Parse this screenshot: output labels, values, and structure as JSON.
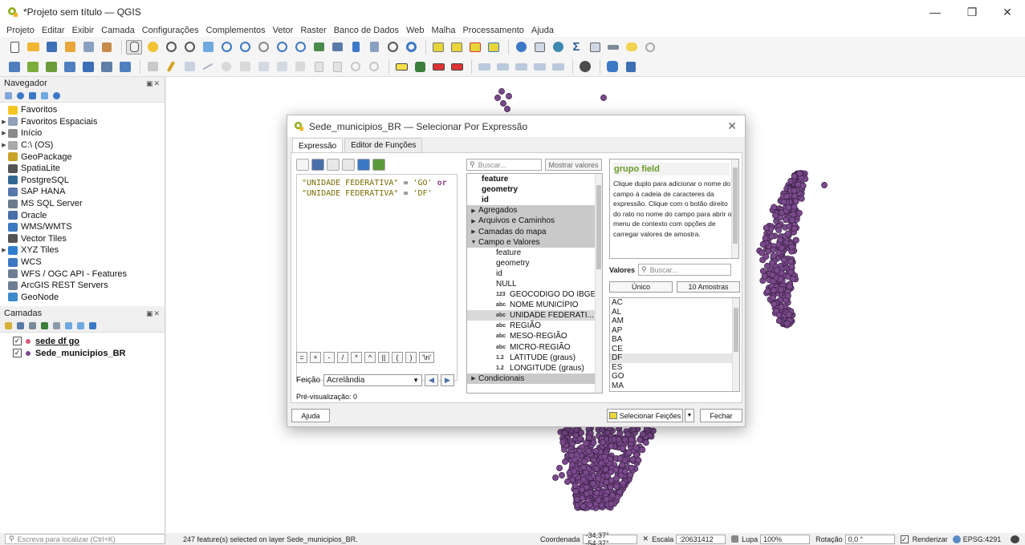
{
  "window": {
    "title": "*Projeto sem título — QGIS",
    "controls": [
      "—",
      "❐",
      "✕"
    ]
  },
  "menu": [
    "Projeto",
    "Editar",
    "Exibir",
    "Camada",
    "Configurações",
    "Complementos",
    "Vetor",
    "Raster",
    "Banco de Dados",
    "Web",
    "Malha",
    "Processamento",
    "Ajuda"
  ],
  "browser": {
    "title": "Navegador",
    "items": [
      {
        "label": "Favoritos",
        "arrow": "",
        "icon": "star-icon",
        "color": "#f3c623"
      },
      {
        "label": "Favoritos Espaciais",
        "arrow": "▶",
        "icon": "spatial-bookmark-icon",
        "color": "#8fa0b8"
      },
      {
        "label": "Início",
        "arrow": "▶",
        "icon": "home-folder-icon",
        "color": "#8a8a8a"
      },
      {
        "label": "C:\\ (OS)",
        "arrow": "▶",
        "icon": "drive-icon",
        "color": "#aaaaaa"
      },
      {
        "label": "GeoPackage",
        "arrow": "",
        "icon": "geopackage-icon",
        "color": "#c9a227"
      },
      {
        "label": "SpatiaLite",
        "arrow": "",
        "icon": "spatialite-icon",
        "color": "#555555"
      },
      {
        "label": "PostgreSQL",
        "arrow": "",
        "icon": "postgresql-icon",
        "color": "#336791"
      },
      {
        "label": "SAP HANA",
        "arrow": "",
        "icon": "sap-hana-icon",
        "color": "#5577aa"
      },
      {
        "label": "MS SQL Server",
        "arrow": "",
        "icon": "mssql-icon",
        "color": "#6b7a8f"
      },
      {
        "label": "Oracle",
        "arrow": "",
        "icon": "oracle-icon",
        "color": "#4a6fa8"
      },
      {
        "label": "WMS/WMTS",
        "arrow": "",
        "icon": "wms-globe-icon",
        "color": "#3b78c2"
      },
      {
        "label": "Vector Tiles",
        "arrow": "",
        "icon": "vector-tiles-icon",
        "color": "#555555"
      },
      {
        "label": "XYZ Tiles",
        "arrow": "▶",
        "icon": "xyz-tiles-icon",
        "color": "#2f7fd1"
      },
      {
        "label": "WCS",
        "arrow": "",
        "icon": "wcs-globe-icon",
        "color": "#3b78c2"
      },
      {
        "label": "WFS / OGC API - Features",
        "arrow": "",
        "icon": "wfs-icon",
        "color": "#6f7f93"
      },
      {
        "label": "ArcGIS REST Servers",
        "arrow": "",
        "icon": "arcgis-icon",
        "color": "#6f7f93"
      },
      {
        "label": "GeoNode",
        "arrow": "",
        "icon": "geonode-icon",
        "color": "#3d8bcc"
      }
    ]
  },
  "layers": {
    "title": "Camadas",
    "items": [
      {
        "label": "sede df go",
        "checked": "✓",
        "color": "#d65a7a",
        "underline": true
      },
      {
        "label": "Sede_municipios_BR",
        "checked": "✓",
        "color": "#7a4a8c",
        "underline": false
      }
    ]
  },
  "dialog": {
    "title": "Sede_municipios_BR — Selecionar Por Expressão",
    "close": "✕",
    "tabs": [
      "Expressão",
      "Editor de Funções"
    ],
    "expression": {
      "s1": "\"UNIDADE FEDERATIVA\"",
      "eq1": " = ",
      "s2": "'GO'",
      "kw": " or ",
      "s3": "\"UNIDADE FEDERATIVA\"",
      "eq2": " = ",
      "s4": "'DF'"
    },
    "operators": [
      "=",
      "+",
      "-",
      "/",
      "*",
      "^",
      "||",
      "(",
      ")",
      "'\\n'"
    ],
    "feature_label": "Feição",
    "feature_value": "Acrelândia",
    "preview": "Pré-visualização:  0",
    "search_placeholder": "Buscar...",
    "show_values": "Mostrar valores",
    "function_list": [
      {
        "label": "feature",
        "kind": "bold"
      },
      {
        "label": "geometry",
        "kind": "bold"
      },
      {
        "label": "id",
        "kind": "bold"
      },
      {
        "label": "Agregados",
        "kind": "group",
        "arrow": "▶"
      },
      {
        "label": "Arquivos e Caminhos",
        "kind": "group",
        "arrow": "▶"
      },
      {
        "label": "Camadas do mapa",
        "kind": "group",
        "arrow": "▶"
      },
      {
        "label": "Campo e Valores",
        "kind": "group",
        "arrow": "▼"
      },
      {
        "label": "feature",
        "kind": "child",
        "type": ""
      },
      {
        "label": "geometry",
        "kind": "child",
        "type": ""
      },
      {
        "label": "id",
        "kind": "child",
        "type": ""
      },
      {
        "label": "NULL",
        "kind": "child",
        "type": ""
      },
      {
        "label": "GEOCODIGO DO IBGE",
        "kind": "child",
        "type": "123"
      },
      {
        "label": "NOME MUNICÍPIO",
        "kind": "child",
        "type": "abc"
      },
      {
        "label": "UNIDADE FEDERATI...",
        "kind": "child sel",
        "type": "abc"
      },
      {
        "label": "REGIÃO",
        "kind": "child",
        "type": "abc"
      },
      {
        "label": "MESO-REGIÃO",
        "kind": "child",
        "type": "abc"
      },
      {
        "label": "MICRO-REGIÃO",
        "kind": "child",
        "type": "abc"
      },
      {
        "label": "LATITUDE (graus)",
        "kind": "child",
        "type": "1.2"
      },
      {
        "label": "LONGITUDE (graus)",
        "kind": "child",
        "type": "1.2"
      },
      {
        "label": "Condicionais",
        "kind": "group",
        "arrow": "▶"
      }
    ],
    "help": {
      "title": "grupo field",
      "body": "Clique duplo para adicionar o nome do campo à cadeia de caracteres da expressão. Clique com o botão direito do rato no nome do campo para abrir o menu de contexto com opções de carregar valores de amostra."
    },
    "values_label": "Valores",
    "values_search": "Buscar...",
    "unique_button": "Único",
    "samples_button": "10 Amostras",
    "values": [
      "AC",
      "AL",
      "AM",
      "AP",
      "BA",
      "CE",
      "DF",
      "ES",
      "GO",
      "MA"
    ],
    "help_button": "Ajuda",
    "select_button": "Selecionar Feições",
    "close_button": "Fechar"
  },
  "status": {
    "locator_placeholder": "Escreva para localizar (Ctrl+K)",
    "message": "247 feature(s) selected on layer Sede_municipios_BR.",
    "coord_label": "Coordenada",
    "coord_value": "-34,37° -54,37°",
    "scale_label": "Escala",
    "scale_value": ":20631412",
    "magnifier_label": "Lupa",
    "magnifier_value": "100%",
    "rotation_label": "Rotação",
    "rotation_value": "0,0 °",
    "render_label": "Renderizar",
    "crs": "EPSG:4291"
  },
  "colors": {
    "point_fill": "#7a4a8c",
    "point_stroke": "#3a2045",
    "accent": "#6a9a2a",
    "selection": "#ffff00"
  }
}
